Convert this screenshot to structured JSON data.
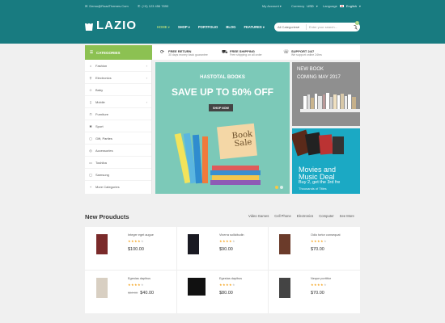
{
  "topbar": {
    "email": "Demo@RoadThemes.Com",
    "phone": "(+0) 123 456 7890",
    "account": "My Account",
    "currency_label": "Currency",
    "currency_value": "USD",
    "language_label": "Language",
    "language_value": "English"
  },
  "header": {
    "logo": "LAZIO",
    "nav": [
      "HOME",
      "SHOP",
      "PORTFOLIO",
      "BLOG",
      "FEATURES"
    ],
    "search_category": "All Categories",
    "search_placeholder": "Enter your search...",
    "cart_count": "0"
  },
  "services": {
    "categories_title": "CATEGORIES",
    "items": [
      {
        "title": "FREE RETURN",
        "sub": "30 days money back guarantee"
      },
      {
        "title": "FREE SHIPPING",
        "sub": "Free shipping on all order"
      },
      {
        "title": "SUPPORT 24/7",
        "sub": "We support online 24hrs"
      }
    ]
  },
  "sidebar": {
    "items": [
      {
        "label": "Fashion",
        "has_sub": true
      },
      {
        "label": "Electronics",
        "has_sub": true
      },
      {
        "label": "Baby",
        "has_sub": false
      },
      {
        "label": "Mobile",
        "has_sub": true
      },
      {
        "label": "Furniture",
        "has_sub": false
      },
      {
        "label": "Sport",
        "has_sub": false
      },
      {
        "label": "Gift, Parties",
        "has_sub": false
      },
      {
        "label": "Accessories",
        "has_sub": false
      },
      {
        "label": "Toshiba",
        "has_sub": false
      },
      {
        "label": "Samsung",
        "has_sub": false
      },
      {
        "label": "More Categories",
        "has_sub": false
      }
    ]
  },
  "banner": {
    "eyebrow": "HASTOTAL BOOKS",
    "headline": "SAVE UP TO 50% OFF",
    "button": "SHOP NOW",
    "note_line1": "Book",
    "note_line2": "Sale"
  },
  "side_banner_1": {
    "line1": "NEW BOOK",
    "line2": "COMING MAY 2017"
  },
  "side_banner_2": {
    "line1": "Movies and",
    "line2": "Music Deal",
    "line3": "Buy 2, get the 3rd fre",
    "line4": "Thousands of Titles"
  },
  "new_products": {
    "title": "New Prouducts",
    "tabs": [
      "Video Games",
      "Cell Phone",
      "Electronics",
      "Computer",
      "See More"
    ],
    "items": [
      {
        "name": "Integer eget augue",
        "rating": 4,
        "price": "$100.00",
        "old_price": ""
      },
      {
        "name": "Viverra sollicitudin",
        "rating": 4,
        "price": "$90.00",
        "old_price": ""
      },
      {
        "name": "Odio tortor consequat",
        "rating": 4,
        "price": "$70.00",
        "old_price": ""
      },
      {
        "name": "Egestas dapibus",
        "rating": 4,
        "price": "$40.00",
        "old_price": "$50.00"
      },
      {
        "name": "Egestas dapibus",
        "rating": 4,
        "price": "$80.00",
        "old_price": ""
      },
      {
        "name": "Neque porttitor",
        "rating": 4,
        "price": "$70.00",
        "old_price": ""
      }
    ]
  },
  "colors": {
    "teal": "#187b80",
    "green": "#8cc152",
    "banner": "#7cc9b8",
    "blue": "#1ba9c4"
  }
}
